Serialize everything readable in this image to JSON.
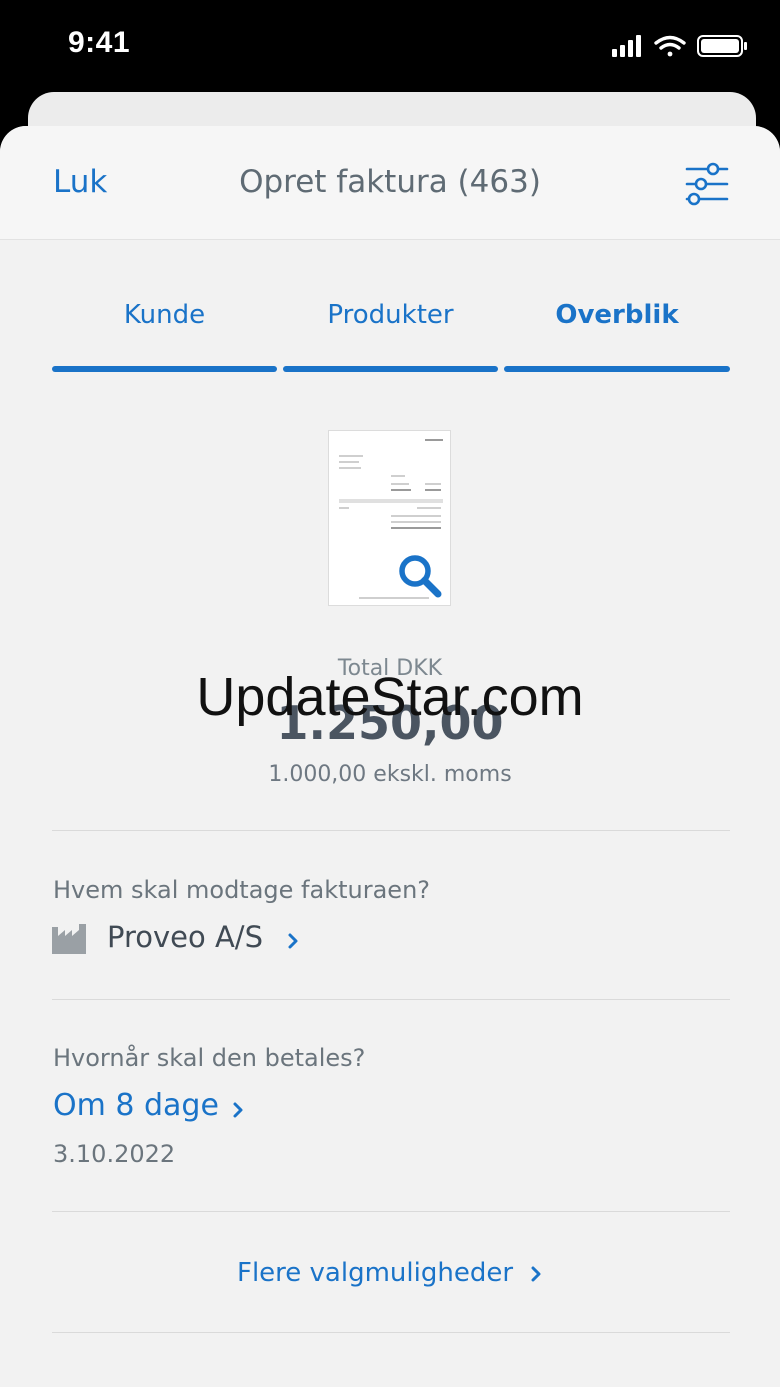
{
  "status_bar": {
    "time": "9:41"
  },
  "nav": {
    "close_label": "Luk",
    "title": "Opret faktura (463)"
  },
  "tabs": [
    {
      "label": "Kunde",
      "active": false
    },
    {
      "label": "Produkter",
      "active": false
    },
    {
      "label": "Overblik",
      "active": true
    }
  ],
  "summary": {
    "total_label": "Total DKK",
    "total_amount": "1.250,00",
    "excl_vat": "1.000,00 ekskl. moms"
  },
  "watermark": "UpdateStar.com",
  "recipient": {
    "question": "Hvem skal modtage fakturaen?",
    "name": "Proveo A/S",
    "icon": "factory-icon"
  },
  "payment": {
    "question": "Hvornår skal den betales?",
    "term": "Om 8 dage",
    "due_date": "3.10.2022"
  },
  "more_options_label": "Flere valgmuligheder",
  "colors": {
    "accent": "#1a73c8",
    "text_muted": "#6b757d",
    "background": "#f2f2f2"
  }
}
